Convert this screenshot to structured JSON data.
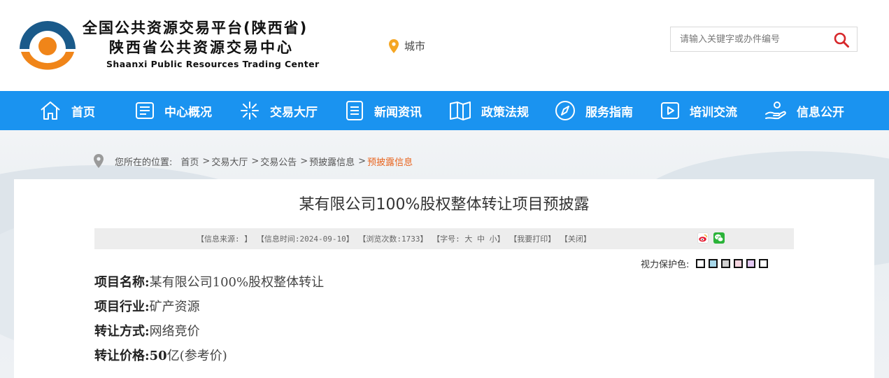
{
  "header": {
    "title_cn_1": "全国公共资源交易平台(陕西省)",
    "title_cn_2": "陕西省公共资源交易中心",
    "title_en": "Shaanxi Public Resources Trading Center",
    "city_label": "城市",
    "search_placeholder": "请输入关键字或办件编号",
    "logo_colors": {
      "blue": "#1a5a8a",
      "orange": "#f08519"
    }
  },
  "nav": {
    "color": "#1a93f0",
    "items": [
      {
        "label": "首页",
        "icon": "home-icon"
      },
      {
        "label": "中心概况",
        "icon": "newspaper-icon"
      },
      {
        "label": "交易大厅",
        "icon": "sparkle-icon"
      },
      {
        "label": "新闻资讯",
        "icon": "document-icon"
      },
      {
        "label": "政策法规",
        "icon": "book-icon"
      },
      {
        "label": "服务指南",
        "icon": "compass-icon"
      },
      {
        "label": "培训交流",
        "icon": "video-icon"
      },
      {
        "label": "信息公开",
        "icon": "hand-icon"
      }
    ]
  },
  "breadcrumb": {
    "prefix": "您所在的位置:",
    "items": [
      "首页",
      "交易大厅",
      "交易公告",
      "预披露信息"
    ],
    "separator": ">",
    "current": "预披露信息",
    "current_color": "#e8641e"
  },
  "article": {
    "title": "某有限公司100%股权整体转让项目预披露",
    "info": {
      "source": "【信息来源: 】",
      "time": "【信息时间:2024-09-10】",
      "views": "【浏览次数:1733】",
      "font_label": "【字号:",
      "font_large": "大",
      "font_medium": "中",
      "font_small": "小】",
      "print": "【我要打印】",
      "close": "【关闭】"
    },
    "share_icons": [
      "weibo-icon",
      "wechat-icon"
    ],
    "eye_care_label": "视力保护色:",
    "eye_care_colors": [
      "#ffffff",
      "#a8d8ea",
      "#d0d0d0",
      "#f7d6e0",
      "#e3c8f2",
      "#ffffff"
    ],
    "fields": [
      {
        "label": "项目名称:",
        "value": "某有限公司100%股权整体转让"
      },
      {
        "label": "项目行业:",
        "value": "矿产资源"
      },
      {
        "label": "转让方式:",
        "value": "网络竞价"
      },
      {
        "label": "转让价格:",
        "value_bold": "50",
        "value": "亿(参考价)"
      }
    ]
  }
}
